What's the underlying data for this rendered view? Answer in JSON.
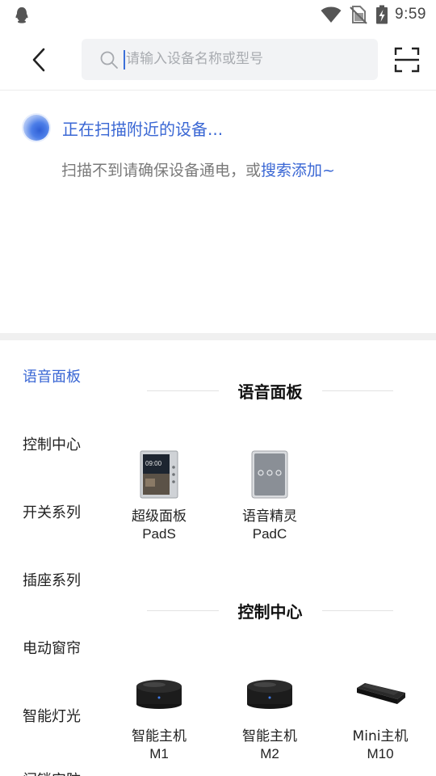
{
  "status_bar": {
    "time": "9:59"
  },
  "search": {
    "placeholder": "请输入设备名称或型号"
  },
  "scanning": {
    "status_text": "正在扫描附近的设备...",
    "hint_prefix": "扫描不到请确保设备通电，或",
    "hint_link": "搜索添加~"
  },
  "sidebar": {
    "items": [
      {
        "label": "语音面板",
        "active": true
      },
      {
        "label": "控制中心"
      },
      {
        "label": "开关系列"
      },
      {
        "label": "插座系列"
      },
      {
        "label": "电动窗帘"
      },
      {
        "label": "智能灯光"
      },
      {
        "label": "门锁安防"
      }
    ]
  },
  "sections": [
    {
      "title": "语音面板",
      "products": [
        {
          "name": "超级面板",
          "model": "PadS",
          "icon": "smart-panel-icon"
        },
        {
          "name": "语音精灵",
          "model": "PadC",
          "icon": "voice-panel-icon"
        }
      ]
    },
    {
      "title": "控制中心",
      "products": [
        {
          "name": "智能主机",
          "model": "M1",
          "icon": "hub-icon"
        },
        {
          "name": "智能主机",
          "model": "M2",
          "icon": "hub-icon"
        },
        {
          "name": "Mini主机",
          "model": "M10",
          "icon": "mini-hub-icon"
        }
      ]
    }
  ],
  "colors": {
    "accent": "#3a67d4",
    "divider": "#f0f0f0",
    "search_bg": "#f2f3f5"
  }
}
